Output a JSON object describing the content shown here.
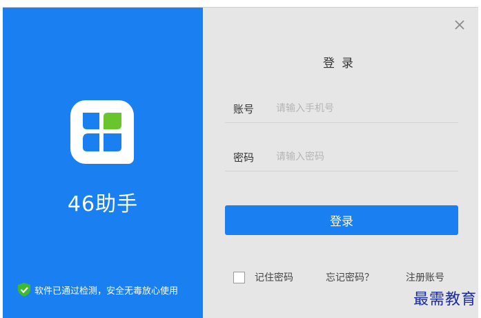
{
  "app": {
    "name": "46助手",
    "safety_text": "软件已通过检测，安全无毒放心使用"
  },
  "login": {
    "title": "登录",
    "account_label": "账号",
    "account_placeholder": "请输入手机号",
    "password_label": "密码",
    "password_placeholder": "请输入密码",
    "submit_label": "登录",
    "remember_label": "记住密码",
    "forgot_label": "忘记密码？",
    "register_label": "注册账号"
  },
  "watermark": "最需教育",
  "colors": {
    "brand_blue": "#1a7ff0",
    "shield_green": "#3dbb2f",
    "logo_green": "#6ac52c",
    "panel_bg": "#e6e6e6"
  },
  "icons": {
    "close": "close-icon",
    "shield": "shield-check-icon",
    "logo": "app-logo-icon"
  }
}
